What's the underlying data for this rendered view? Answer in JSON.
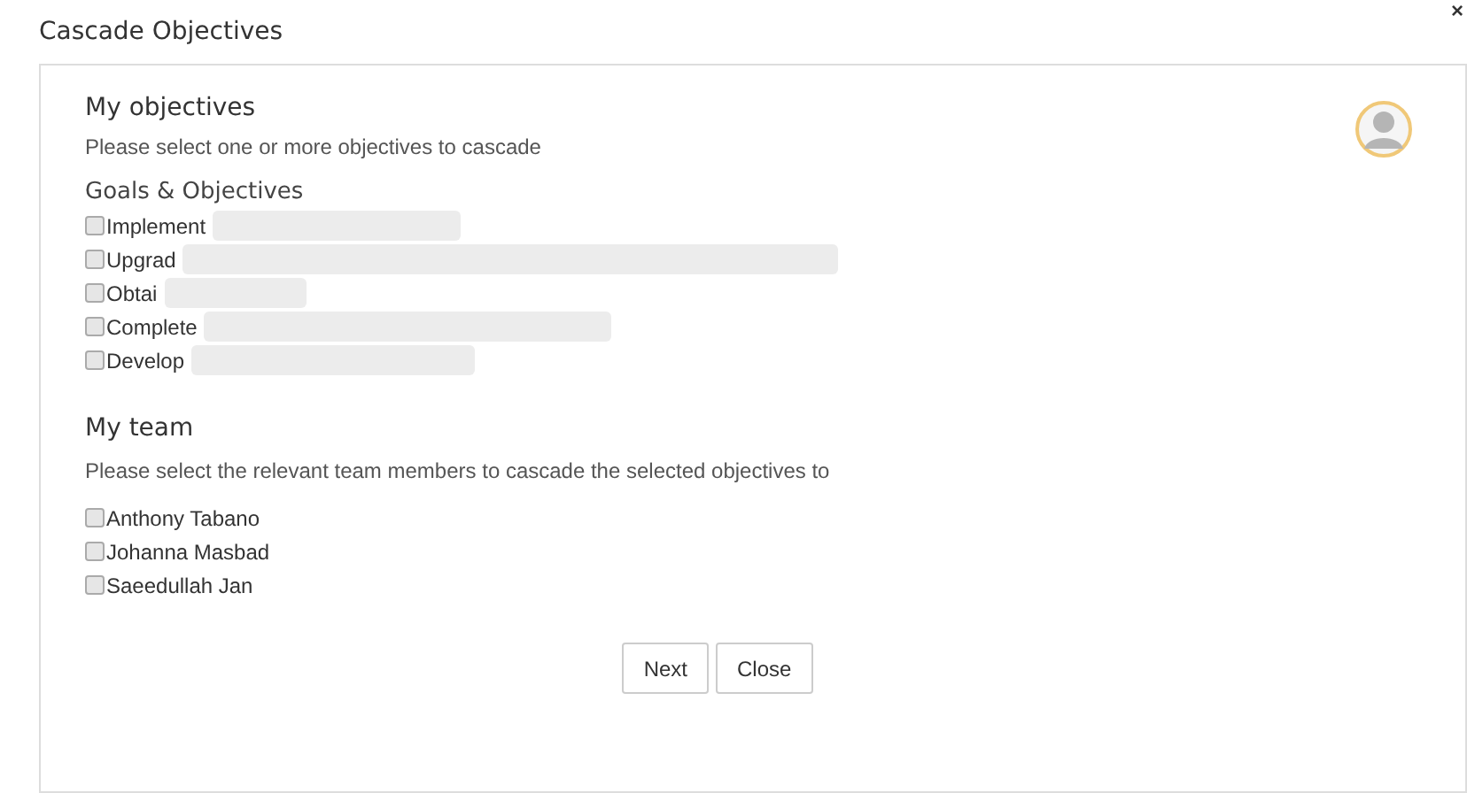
{
  "dialog": {
    "title": "Cascade Objectives",
    "close": "×"
  },
  "objectives": {
    "heading": "My objectives",
    "instruction": "Please select one or more objectives to cascade",
    "group": "Goals & Objectives",
    "items": [
      {
        "label": "Implement",
        "checked": false
      },
      {
        "label": "Upgrad",
        "checked": false
      },
      {
        "label": "Obtai",
        "checked": false
      },
      {
        "label": "Complete",
        "checked": false
      },
      {
        "label": "Develop",
        "checked": false
      }
    ]
  },
  "team": {
    "heading": "My team",
    "instruction": "Please select the relevant team members to cascade the selected objectives to",
    "members": [
      {
        "label": "Anthony Tabano",
        "checked": false
      },
      {
        "label": "Johanna Masbad",
        "checked": false
      },
      {
        "label": "Saeedullah Jan",
        "checked": false
      }
    ]
  },
  "buttons": [
    "Next",
    "Close"
  ]
}
